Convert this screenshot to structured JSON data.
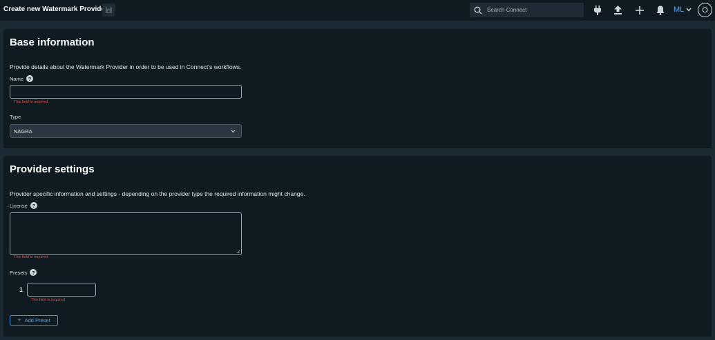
{
  "header": {
    "title": "Create new Watermark Provider",
    "search_placeholder": "Search Connect",
    "user_initials": "ML",
    "avatar_letter": "O",
    "icons": [
      "save-icon",
      "search-icon",
      "plug-icon",
      "upload-icon",
      "plus-icon",
      "bell-icon",
      "chevron-down-icon"
    ]
  },
  "base_info": {
    "title": "Base information",
    "description": "Provide details about the Watermark Provider in order to be used in Connect's workflows.",
    "name_label": "Name",
    "name_value": "",
    "name_error": "This field is required",
    "type_label": "Type",
    "type_value": "NAGRA"
  },
  "provider_settings": {
    "title": "Provider settings",
    "description": "Provider specific information and settings - depending on the provider type the required information might change.",
    "license_label": "License",
    "license_value": "",
    "license_error": "This field is required",
    "presets_label": "Presets",
    "presets": [
      {
        "index": "1",
        "value": "",
        "error": "This field is required"
      }
    ],
    "add_preset_label": "Add Preset"
  },
  "colors": {
    "background": "#1b2a33",
    "card": "#0f1a21",
    "accent": "#5aa0e6",
    "error": "#e5534b"
  }
}
